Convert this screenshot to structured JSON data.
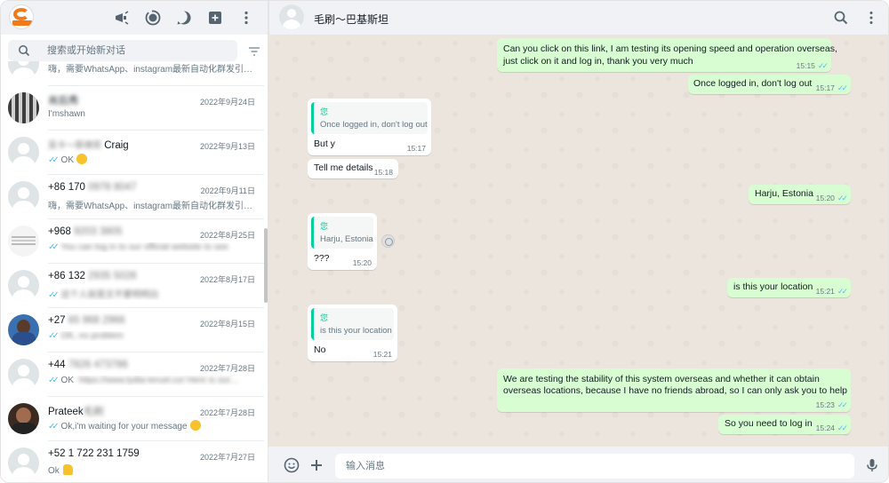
{
  "sidebar": {
    "header_icons": [
      "communities-icon",
      "status-icon",
      "channels-icon",
      "new-chat-icon",
      "menu-icon"
    ],
    "search_placeholder": "搜索或开始新对话",
    "chats": [
      {
        "name": "",
        "date": "",
        "preview": "嗨，需要WhatsApp、instagram最新自动化群发引…",
        "ticks": false,
        "blurred": false,
        "avatar": "default"
      },
      {
        "name": "肖后秀",
        "date": "2022年9月24日",
        "preview": "I'mshawn",
        "ticks": false,
        "blurred": true,
        "avatar": "photo-bars"
      },
      {
        "name": "Craig",
        "name_prefix": "吴卡～菲律宾",
        "date": "2022年9月13日",
        "preview": "OK",
        "ticks": true,
        "emoji": true,
        "blurred": false,
        "avatar": "default"
      },
      {
        "name": "+86 170",
        "name_suffix": "0978 8047",
        "date": "2022年9月11日",
        "preview": "嗨，需要WhatsApp、instagram最新自动化群发引…",
        "ticks": false,
        "blurred": false,
        "avatar": "default"
      },
      {
        "name": "+968",
        "name_suffix": "9203 3805",
        "date": "2022年8月25日",
        "preview": "You can log in to our official website to see",
        "ticks": true,
        "blurred": true,
        "avatar": "photo-text"
      },
      {
        "name": "+86 132",
        "name_suffix": "2935 5028",
        "date": "2022年8月17日",
        "preview": "这个人就是文不要明明白",
        "ticks": true,
        "blurred": true,
        "avatar": "default"
      },
      {
        "name": "+27",
        "name_suffix": "65 968 2966",
        "date": "2022年8月15日",
        "preview": "OK, no problem",
        "ticks": true,
        "blurred": true,
        "avatar": "photo-person"
      },
      {
        "name": "+44",
        "name_suffix": "7826 473786",
        "date": "2022年7月28日",
        "preview": "OK",
        "preview_suffix": "https://www.lydia-teruel.co/ Here is our…",
        "ticks": true,
        "blurred": false,
        "avatar": "default"
      },
      {
        "name": "Prateek",
        "name_suffix": "毛刷",
        "date": "2022年7月28日",
        "preview": "Ok,i'm waiting for your message",
        "ticks": true,
        "emoji": true,
        "blurred": false,
        "avatar": "photo-dark"
      },
      {
        "name": "+52 1 722 231 1759",
        "date": "2022年7月27日",
        "preview": "Ok",
        "ticks": false,
        "thumb": true,
        "blurred": false,
        "avatar": "default"
      }
    ]
  },
  "conversation": {
    "contact_name": "毛刷～巴基斯坦",
    "messages": [
      {
        "dir": "out",
        "lines": [
          "Can you click on this link, I am testing its opening speed and operation overseas,",
          "just click on it and log in, thank you very much"
        ],
        "time": "15:15"
      },
      {
        "dir": "out",
        "lines": [
          "Once logged in, don't log out"
        ],
        "time": "15:17"
      },
      {
        "dir": "in",
        "quote_author": "您",
        "quote_text": "Once logged in, don't log out",
        "lines": [
          "But y"
        ],
        "time": "15:17"
      },
      {
        "dir": "in",
        "lines": [
          "Tell me details"
        ],
        "time": "15:18"
      },
      {
        "dir": "out",
        "lines": [
          "Harju, Estonia"
        ],
        "time": "15:20"
      },
      {
        "dir": "in",
        "quote_author": "您",
        "quote_text": "Harju, Estonia",
        "lines": [
          "???"
        ],
        "time": "15:20"
      },
      {
        "dir": "out",
        "lines": [
          "is this your location"
        ],
        "time": "15:21"
      },
      {
        "dir": "in",
        "quote_author": "您",
        "quote_text": "is this your location",
        "lines": [
          "No"
        ],
        "time": "15:21"
      },
      {
        "dir": "out",
        "lines": [
          "We are testing the stability of this system overseas and whether it can obtain",
          "overseas locations, because I have no friends abroad, so I can only ask you to help"
        ],
        "time": "15:23"
      },
      {
        "dir": "out",
        "lines": [
          "So you need to log in"
        ],
        "time": "15:24"
      }
    ],
    "composer_placeholder": "输入消息",
    "read_ticks": "✓✓"
  },
  "colors": {
    "outgoing": "#d9fdd3",
    "incoming": "#ffffff",
    "accent": "#06cf9c",
    "tick_read": "#53bdeb",
    "background": "#ece5dd"
  }
}
